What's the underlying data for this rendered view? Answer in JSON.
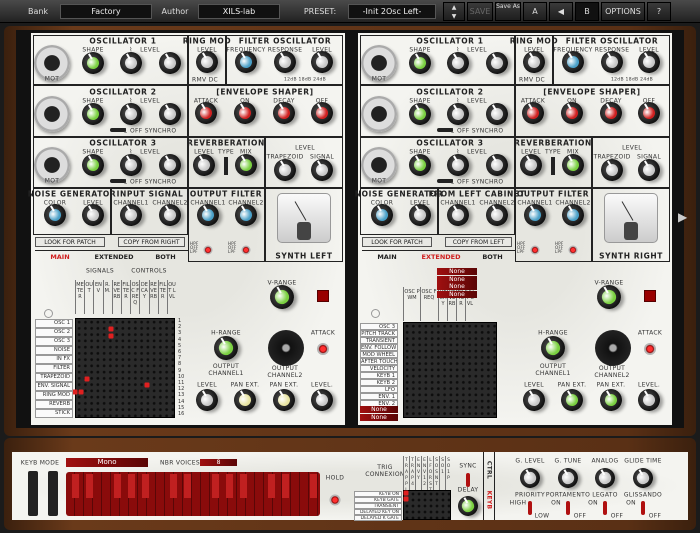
{
  "toolbar": {
    "bank_label": "Bank",
    "bank_value": "Factory",
    "author_label": "Author",
    "author_value": "XILS-lab",
    "preset_label": "PRESET:",
    "preset_value": "-Init 2Osc Left-",
    "save": "SAVE",
    "save_as": "Save As",
    "a": "A",
    "b": "B",
    "options": "OPTIONS",
    "help": "?"
  },
  "colors": {
    "green": "#7ad040",
    "blue": "#4aa0c8",
    "red": "#d02020",
    "grey": "#c8c8c8",
    "yellow": "#e8e4a0",
    "wood": "#5a3015"
  },
  "panels": [
    {
      "osc1": "OSCILLATOR 1",
      "osc2": "OSCILLATOR 2",
      "osc3": "OSCILLATOR 3",
      "shape": "SHAPE",
      "level": "LEVEL",
      "ring_mod": "RING MOD",
      "rmv_dc": "RMV DC",
      "filter_osc": "FILTER OSCILLATOR",
      "frequency": "FREQUENCY",
      "response": "RESPONSE",
      "db": "12dB 18dB 24dB",
      "env": "[ENVELOPE  SHAPER]",
      "attack": "ATTACK",
      "on": "ON",
      "decay": "DECAY",
      "off": "OFF",
      "synchro": "1   OFF   SYNCHRO",
      "reverb": "REVERBERATION",
      "type": "TYPE",
      "mix": "MIX",
      "trapezoid": "TRAPEZOID",
      "signal": "SIGNAL",
      "noise": "NOISE GENERATOR",
      "color": "COLOR",
      "input": "INPUT SIGNAL",
      "ch1": "CHANNEL1",
      "ch2": "CHANNEL2",
      "out_filter": "OUTPUT FILTER",
      "hpf": "HPF OFF LPF",
      "synth": "SYNTH LEFT",
      "look": "LOOK FOR PATCH",
      "copy": "COPY FROM RIGHT",
      "tabs": [
        "MAIN",
        "EXTENDED",
        "BOTH"
      ],
      "active_tab": 0,
      "mot": "MOT"
    },
    {
      "osc1": "OSCILLATOR 1",
      "osc2": "OSCILLATOR 2",
      "osc3": "OSCILLATOR 3",
      "shape": "SHAPE",
      "level": "LEVEL",
      "ring_mod": "RING MOD",
      "rmv_dc": "RMV DC",
      "filter_osc": "FILTER OSCILLATOR",
      "frequency": "FREQUENCY",
      "response": "RESPONSE",
      "db": "12dB 18dB 24dB",
      "env": "[ENVELOPE  SHAPER]",
      "attack": "ATTACK",
      "on": "ON",
      "decay": "DECAY",
      "off": "OFF",
      "synchro": "1   OFF   SYNCHRO",
      "reverb": "REVERBERATION",
      "type": "TYPE",
      "mix": "MIX",
      "trapezoid": "TRAPEZOID",
      "signal": "SIGNAL",
      "noise": "NOISE GENERATOR",
      "color": "COLOR",
      "input": "FROM LEFT CABINET",
      "ch1": "CHANNEL1",
      "ch2": "CHANNEL2",
      "out_filter": "OUTPUT FILTER",
      "hpf": "HPF OFF LPF",
      "synth": "SYNTH RIGHT",
      "look": "LOOK FOR PATCH",
      "copy": "COPY FROM LEFT",
      "tabs": [
        "MAIN",
        "EXTENDED",
        "BOTH"
      ],
      "active_tab": 1,
      "mot": "MOT"
    }
  ],
  "lower": {
    "v_range": "V-RANGE",
    "h_range": "H-RANGE",
    "attack": "ATTACK",
    "out_ch1": "OUTPUT CHANNEL1",
    "out_ch2": "OUTPUT CHANNEL2",
    "level": "LEVEL",
    "pan": "PAN EXT.",
    "level2": "LEVEL."
  },
  "main_matrix": {
    "signals": "SIGNALS",
    "controls": "CONTROLS",
    "columns": [
      "METER",
      "OUT",
      "ENV",
      "R.M.",
      "REVERB",
      "FILTER",
      "OSC FREQ",
      "DECAY",
      "REVERB",
      "FILTER",
      "OUT LVL"
    ],
    "rows": [
      "OSC 1",
      "OSC 2",
      "OSC 3",
      "NOISE",
      "IN FX",
      "FILTER",
      "TRAPEZOID",
      "ENV. SIGNAL",
      "RING MOD",
      "REVERB",
      "STICK"
    ],
    "numbers": [
      "1",
      "2",
      "3",
      "4",
      "5",
      "6",
      "7",
      "8",
      "9",
      "10",
      "11",
      "12",
      "13",
      "14",
      "15",
      "16"
    ]
  },
  "ext_matrix": {
    "columns": [
      "OSC PWM",
      "OSC FREQ",
      "DECAY",
      "REVERB",
      "FILTER",
      "OUT LVL"
    ],
    "rows": [
      "OSC 3",
      "PITCH TRACK",
      "TRANSIENT",
      "ENV. FOLLOW",
      "MOD WHEEL",
      "AFTER TOUCH",
      "VELOCITY",
      "KEYB 1",
      "KEYB 2",
      "LFO",
      "ENV. 1",
      "ENV. 2"
    ],
    "top_selects": [
      "None",
      "None",
      "None",
      "None"
    ],
    "bottom_selects": [
      "None",
      "None"
    ]
  },
  "keyboard": {
    "keyb_mode": "KEYB MODE",
    "mode": "Mono",
    "nbr_voices": "NBR VOICES",
    "voices": "8",
    "hold": "HOLD",
    "trig": "TRIG CONNEXION",
    "trig_cols": [
      "TRAPPL",
      "TRAP4",
      "ENVY",
      "ENV12",
      "LFORST",
      "SOSNT",
      "SO1",
      "SO1P"
    ],
    "trig_rows": [
      "KEYB ON",
      "KEYB GATE",
      "TRANSIENT",
      "DELAYED KEY ON",
      "DELAYED K GATE"
    ],
    "sync": "SYNC",
    "delay": "DELAY",
    "ctrl": "CTRL",
    "keyb": "KEYB",
    "g_level": "G. LEVEL",
    "g_tune": "G. TUNE",
    "analog": "ANALOG",
    "glide": "GLIDE TIME",
    "priority": "PRIORITY",
    "high": "HIGH",
    "low": "LOW",
    "portamento": "PORTAMENTO",
    "legato": "LEGATO",
    "glissando": "GLISSANDO",
    "on": "ON",
    "off": "OFF"
  }
}
